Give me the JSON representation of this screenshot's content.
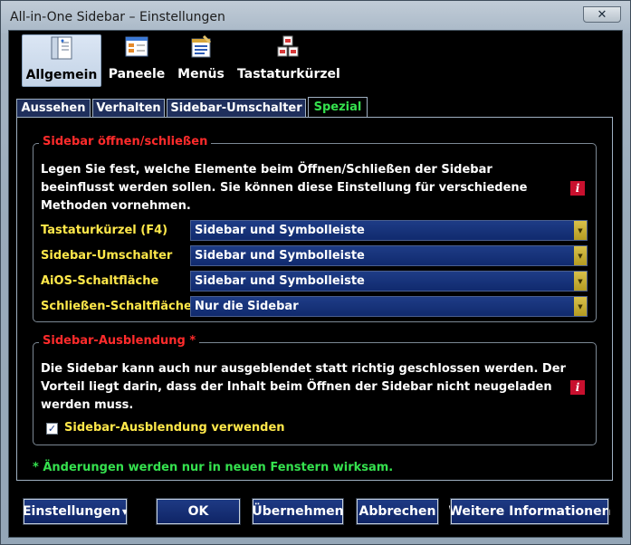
{
  "window": {
    "title": "All-in-One Sidebar – Einstellungen",
    "close_glyph": "✕"
  },
  "toolbar": {
    "items": [
      {
        "label": "Allgemein",
        "active": true,
        "icon": "sidebar-layout-icon"
      },
      {
        "label": "Paneele",
        "active": false,
        "icon": "panel-window-icon"
      },
      {
        "label": "Menüs",
        "active": false,
        "icon": "menu-list-icon"
      },
      {
        "label": "Tastaturkürzel",
        "active": false,
        "icon": "keyboard-shortcut-icon"
      }
    ]
  },
  "tabs": [
    {
      "label": "Aussehen",
      "active": false
    },
    {
      "label": "Verhalten",
      "active": false
    },
    {
      "label": "Sidebar-Umschalter",
      "active": false
    },
    {
      "label": "Spezial",
      "active": true
    }
  ],
  "group_open_close": {
    "title": "Sidebar öffnen/schließen",
    "description": "Legen Sie fest, welche Elemente beim Öffnen/Schließen der Sidebar beeinflusst werden sollen. Sie können diese Einstellung für verschiedene Methoden vornehmen.",
    "info_glyph": "i",
    "rows": [
      {
        "label": "Tastaturkürzel (F4)",
        "value": "Sidebar und Symbolleiste"
      },
      {
        "label": "Sidebar-Umschalter",
        "value": "Sidebar und Symbolleiste"
      },
      {
        "label": "AiOS-Schaltfläche",
        "value": "Sidebar und Symbolleiste"
      },
      {
        "label": "Schließen-Schaltfläche",
        "value": "Nur die Sidebar"
      }
    ]
  },
  "group_collapse": {
    "title": "Sidebar-Ausblendung *",
    "description": "Die Sidebar kann auch nur ausgeblendet statt richtig geschlossen werden. Der Vorteil liegt darin, dass der Inhalt beim Öffnen der Sidebar nicht neugeladen werden muss.",
    "info_glyph": "i",
    "checkbox_label": "Sidebar-Ausblendung verwenden",
    "checkbox_checked": true,
    "check_glyph": "✓"
  },
  "note": "* Änderungen werden nur in neuen Fenstern wirksam.",
  "buttons": {
    "settings": "Einstellungen",
    "settings_arrow": "▼",
    "ok": "OK",
    "apply": "Übernehmen",
    "cancel": "Abbrechen",
    "more_info": "Weitere Informationen"
  },
  "colors": {
    "accent_green": "#35e14e",
    "group_title_red": "#ff2b2b",
    "label_yellow": "#ffe84a",
    "select_blue": "#1e3c86"
  }
}
